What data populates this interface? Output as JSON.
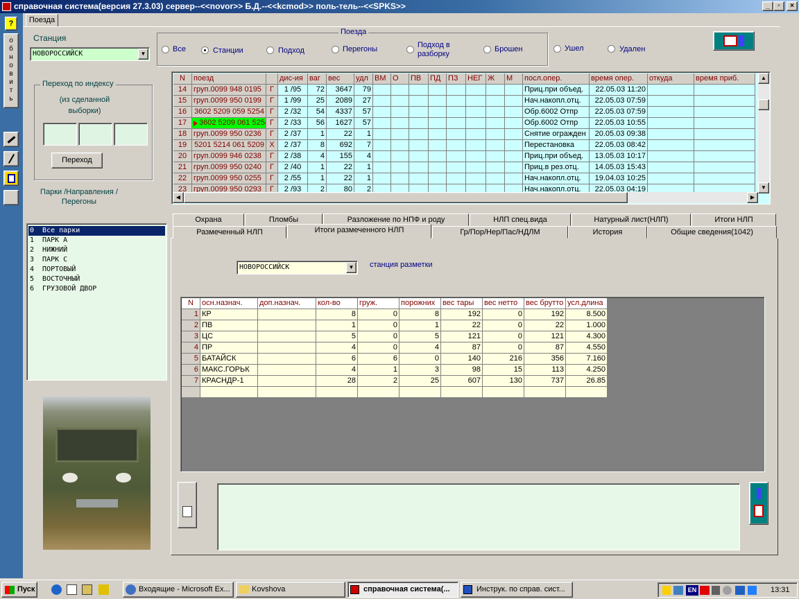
{
  "window": {
    "title": "справочная система(версия 27.3.03) сервер--<<novor>> Б.Д.--<<kcmod>> поль-тель--<<SPKS>>",
    "controls": [
      "_",
      "▫",
      "×"
    ]
  },
  "main_tab": "Поезда",
  "left_toolbar": {
    "help": "?",
    "refresh": "обновить"
  },
  "station": {
    "label": "Станция",
    "value": "НОВОРОССИЙСК"
  },
  "index_jump": {
    "title": "Переход  по индексу",
    "note": "(из сделанной выборки)",
    "fields": [
      "",
      "",
      ""
    ],
    "button": "Переход"
  },
  "parks": {
    "label": "Парки /Направления / Перегоны",
    "items": [
      "0  Все парки",
      "1  ПАРК А",
      "2  НИЖНИЙ",
      "3  ПАРК С",
      "4  ПОРТОВЫЙ",
      "5  ВОСТОЧНЫЙ",
      "6  ГРУЗОВОЙ ДВОР"
    ],
    "selected": 0
  },
  "trains_filter": {
    "label": "Поезда",
    "options": [
      "Все",
      "Станции",
      "Подход",
      "Перегоны",
      "Подход в разборку",
      "Брошен",
      "Ушел",
      "Удален"
    ],
    "selected": 1
  },
  "trains_table": {
    "columns": [
      "N",
      "поезд",
      "",
      "дис-ия",
      "ваг",
      "вес",
      "удл",
      "ВМ",
      "О",
      "ПВ",
      "ПД",
      "ПЗ",
      "НЕГ",
      "Ж",
      "М",
      "посл.опер.",
      "время опер.",
      "откуда",
      "время приб."
    ],
    "rows": [
      [
        "14",
        "груп.0099 948 0195",
        "Г",
        "1 /95",
        "72",
        "3647",
        "79",
        "",
        "",
        "",
        "",
        "",
        "",
        "",
        "",
        "Приц.при объед.",
        "22.05.03 11:20",
        "",
        ""
      ],
      [
        "15",
        "груп.0099 950 0199",
        "Г",
        "1 /99",
        "25",
        "2089",
        "27",
        "",
        "",
        "",
        "",
        "",
        "",
        "",
        "",
        "Нач.накопл.отц.",
        "22.05.03 07:59",
        "",
        ""
      ],
      [
        "16",
        "3602 5209 059 5254",
        "Г",
        "2 /32",
        "54",
        "4337",
        "57",
        "",
        "",
        "",
        "",
        "",
        "",
        "",
        "",
        "Обр.6002 Отпр",
        "22.05.03 07:59",
        "",
        ""
      ],
      [
        "17",
        "3602 5209 061 5254",
        "Г",
        "2 /33",
        "56",
        "1627",
        "57",
        "",
        "",
        "",
        "",
        "",
        "",
        "",
        "",
        "Обр.6002 Отпр",
        "22.05.03 10:55",
        "",
        ""
      ],
      [
        "18",
        "груп.0099 950 0236",
        "Г",
        "2 /37",
        "1",
        "22",
        "1",
        "",
        "",
        "",
        "",
        "",
        "",
        "",
        "",
        "Снятие огражден",
        "20.05.03 09:38",
        "",
        ""
      ],
      [
        "19",
        "5201 5214 061 5209",
        "Х",
        "2 /37",
        "8",
        "692",
        "7",
        "",
        "",
        "",
        "",
        "",
        "",
        "",
        "",
        "Перестановка",
        "22.05.03 08:42",
        "",
        ""
      ],
      [
        "20",
        "груп.0099 946 0238",
        "Г",
        "2 /38",
        "4",
        "155",
        "4",
        "",
        "",
        "",
        "",
        "",
        "",
        "",
        "",
        "Приц.при объед.",
        "13.05.03 10:17",
        "",
        ""
      ],
      [
        "21",
        "груп.0099 950 0240",
        "Г",
        "2 /40",
        "1",
        "22",
        "1",
        "",
        "",
        "",
        "",
        "",
        "",
        "",
        "",
        "Приц.в рез.отц.",
        "14.05.03 15:43",
        "",
        ""
      ],
      [
        "22",
        "груп.0099 950 0255",
        "Г",
        "2 /55",
        "1",
        "22",
        "1",
        "",
        "",
        "",
        "",
        "",
        "",
        "",
        "",
        "Нач.накопл.отц.",
        "19.04.03 10:25",
        "",
        ""
      ],
      [
        "23",
        "груп.0099 950 0293",
        "Г",
        "2 /93",
        "2",
        "80",
        "2",
        "",
        "",
        "",
        "",
        "",
        "",
        "",
        "",
        "Нач.накопл.отц.",
        "22.05.03 04:19",
        "",
        ""
      ]
    ],
    "selected_row": 3
  },
  "tabs_row1": [
    "Охрана",
    "Пломбы",
    "Разложение по НПФ и роду",
    "НЛП спец.вида",
    "Натурный лист(НЛП)",
    "Итоги НЛП"
  ],
  "tabs_row2": [
    "Размеченный НЛП",
    "Итоги размеченного НЛП",
    "Гр/Пор/Нер/Пас/НДЛМ",
    "История",
    "Общие сведения(1042)"
  ],
  "active_tab": "Итоги размеченного НЛП",
  "markup_station": {
    "value": "НОВОРОССИЙСК",
    "label": "станция разметки"
  },
  "summary_table": {
    "columns": [
      "N",
      "осн.назнач.",
      "доп.назнач.",
      "кол-во",
      "груж.",
      "порожних",
      "вес тары",
      "вес нетто",
      "вес брутто",
      "усл.длина"
    ],
    "rows": [
      [
        "1",
        "КР",
        "",
        "8",
        "0",
        "8",
        "192",
        "0",
        "192",
        "8.500"
      ],
      [
        "2",
        "ПВ",
        "",
        "1",
        "0",
        "1",
        "22",
        "0",
        "22",
        "1.000"
      ],
      [
        "3",
        "ЦС",
        "",
        "5",
        "0",
        "5",
        "121",
        "0",
        "121",
        "4.300"
      ],
      [
        "4",
        "ПР",
        "",
        "4",
        "0",
        "4",
        "87",
        "0",
        "87",
        "4.550"
      ],
      [
        "5",
        "БАТАЙСК",
        "",
        "6",
        "6",
        "0",
        "140",
        "216",
        "356",
        "7.160"
      ],
      [
        "6",
        "МАКС.ГОРЬК",
        "",
        "4",
        "1",
        "3",
        "98",
        "15",
        "113",
        "4.250"
      ],
      [
        "7",
        "КРАСНДР-1",
        "",
        "28",
        "2",
        "25",
        "607",
        "130",
        "737",
        "26.85"
      ]
    ]
  },
  "memo": "",
  "taskbar": {
    "start": "Пуск",
    "buttons": [
      "Входящие - Microsoft Ex...",
      "Kovshova",
      "справочная система(...",
      "Инструк. по справ. сист..."
    ],
    "active": 2,
    "tray_lang": "EN",
    "clock": "13:31"
  },
  "colors": {
    "title_start": "#0a246a",
    "grid_bg": "#ccffff",
    "row_bg": "#ffffe1",
    "selected": "#00ff00",
    "header_text": "#800000"
  }
}
